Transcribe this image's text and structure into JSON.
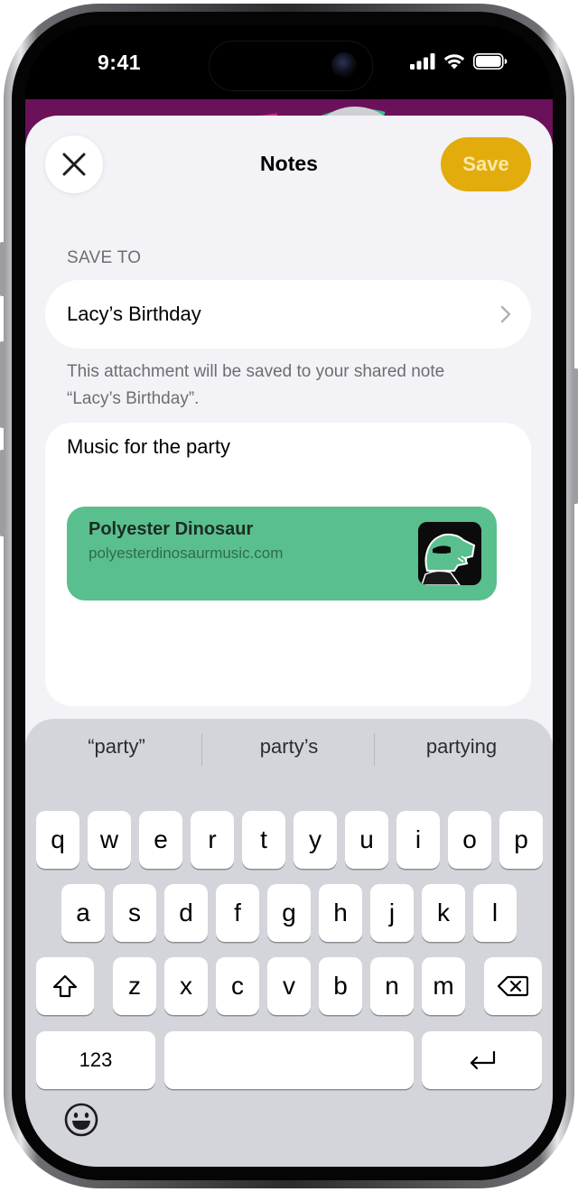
{
  "status_bar": {
    "time": "9:41"
  },
  "sheet": {
    "title": "Notes",
    "save_label": "Save",
    "section_label": "SAVE TO",
    "destination": "Lacy’s Birthday",
    "footnote": "This attachment will be saved to your shared note “Lacy’s Birthday”.",
    "note_text": "Music for the party",
    "link_card": {
      "title": "Polyester Dinosaur",
      "url": "polyesterdinosaurmusic.com"
    }
  },
  "keyboard": {
    "suggestions": [
      "“party”",
      "party’s",
      "partying"
    ],
    "row1": [
      "q",
      "w",
      "e",
      "r",
      "t",
      "y",
      "u",
      "i",
      "o",
      "p"
    ],
    "row2": [
      "a",
      "s",
      "d",
      "f",
      "g",
      "h",
      "j",
      "k",
      "l"
    ],
    "row3": [
      "z",
      "x",
      "c",
      "v",
      "b",
      "n",
      "m"
    ],
    "numbers_label": "123"
  },
  "colors": {
    "save_button": "#e2ac0d",
    "link_card": "#5abf8e",
    "sheet_bg": "#f2f2f7",
    "keyboard_bg": "#d4d5db"
  }
}
